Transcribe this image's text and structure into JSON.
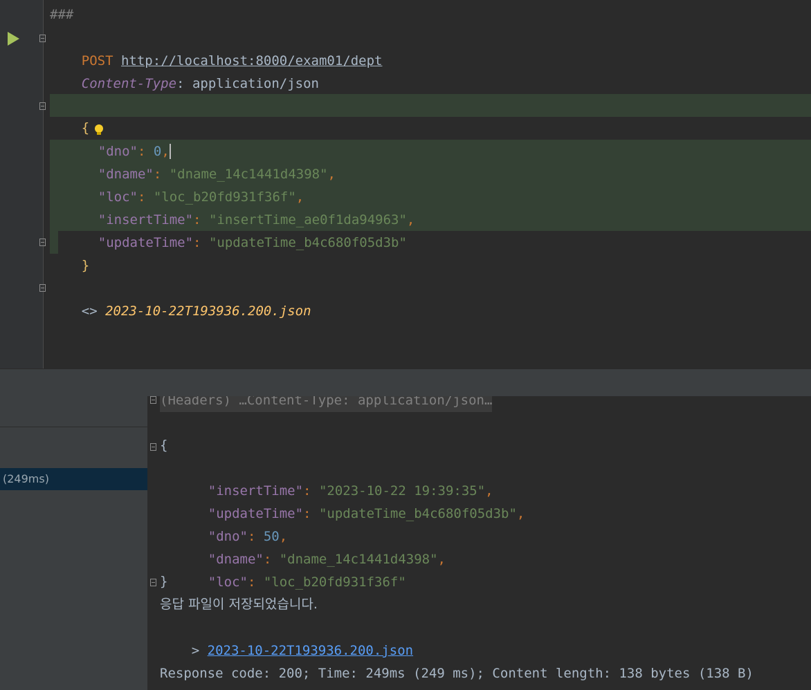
{
  "request": {
    "separator": "###",
    "method": "POST",
    "url": "http://localhost:8000/exam01/dept",
    "header_name": "Content-Type",
    "header_sep": ":",
    "header_value": " application/json",
    "open_brace": "{",
    "close_brace": "}",
    "body": [
      {
        "key": "\"dno\"",
        "value": "0",
        "sep": ","
      },
      {
        "key": "\"dname\"",
        "value": "\"dname_14c1441d4398\"",
        "sep": ","
      },
      {
        "key": "\"loc\"",
        "value": "\"loc_b20fd931f36f\"",
        "sep": ","
      },
      {
        "key": "\"insertTime\"",
        "value": "\"insertTime_ae0f1da94963\"",
        "sep": ","
      },
      {
        "key": "\"updateTime\"",
        "value": "\"updateTime_b4c680f05d3b\"",
        "sep": ""
      }
    ],
    "response_ref_prefix": "<>",
    "response_ref": "2023-10-22T193936.200.json"
  },
  "services_panel": {
    "timing": "(249ms)"
  },
  "response": {
    "headers_collapsed": "(Headers) …Content-Type: application/json…",
    "open_brace": "{",
    "close_brace": "}",
    "body": [
      {
        "key": "\"insertTime\"",
        "value": "\"2023-10-22 19:39:35\"",
        "sep": ","
      },
      {
        "key": "\"updateTime\"",
        "value": "\"updateTime_b4c680f05d3b\"",
        "sep": ","
      },
      {
        "key": "\"dno\"",
        "value": "50",
        "sep": ","
      },
      {
        "key": "\"dname\"",
        "value": "\"dname_14c1441d4398\"",
        "sep": ","
      },
      {
        "key": "\"loc\"",
        "value": "\"loc_b20fd931f36f\"",
        "sep": ""
      }
    ],
    "saved_message": "응답 파일이 저장되었습니다.",
    "file_prefix": "> ",
    "file_link": "2023-10-22T193936.200.json",
    "status_line": "Response code: 200; Time: 249ms (249 ms); Content length: 138 bytes (138 B)"
  }
}
